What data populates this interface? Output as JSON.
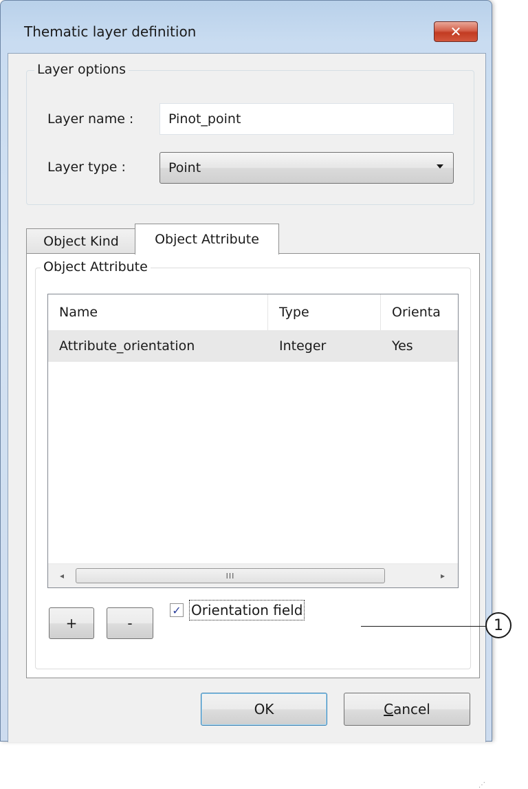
{
  "window": {
    "title": "Thematic layer definition",
    "close_symbol": "✕"
  },
  "layer_options": {
    "legend": "Layer options",
    "name_label": "Layer name :",
    "name_value": "Pinot_point",
    "type_label": "Layer type :",
    "type_value": "Point"
  },
  "tabs": [
    {
      "label": "Object Kind",
      "active": false
    },
    {
      "label": "Object Attribute",
      "active": true
    }
  ],
  "attributes": {
    "legend": "Object Attribute",
    "columns": [
      "Name",
      "Type",
      "Orienta"
    ],
    "rows": [
      {
        "name": "Attribute_orientation",
        "type": "Integer",
        "orientation": "Yes"
      }
    ],
    "scroll": {
      "left": "◂",
      "right": "▸",
      "grip": "III"
    },
    "add_label": "+",
    "remove_label": "-",
    "orientation_checkbox": {
      "label": "Orientation field",
      "checked": true
    }
  },
  "callout": {
    "number": "1"
  },
  "buttons": {
    "ok": "OK",
    "cancel": "Cancel"
  }
}
